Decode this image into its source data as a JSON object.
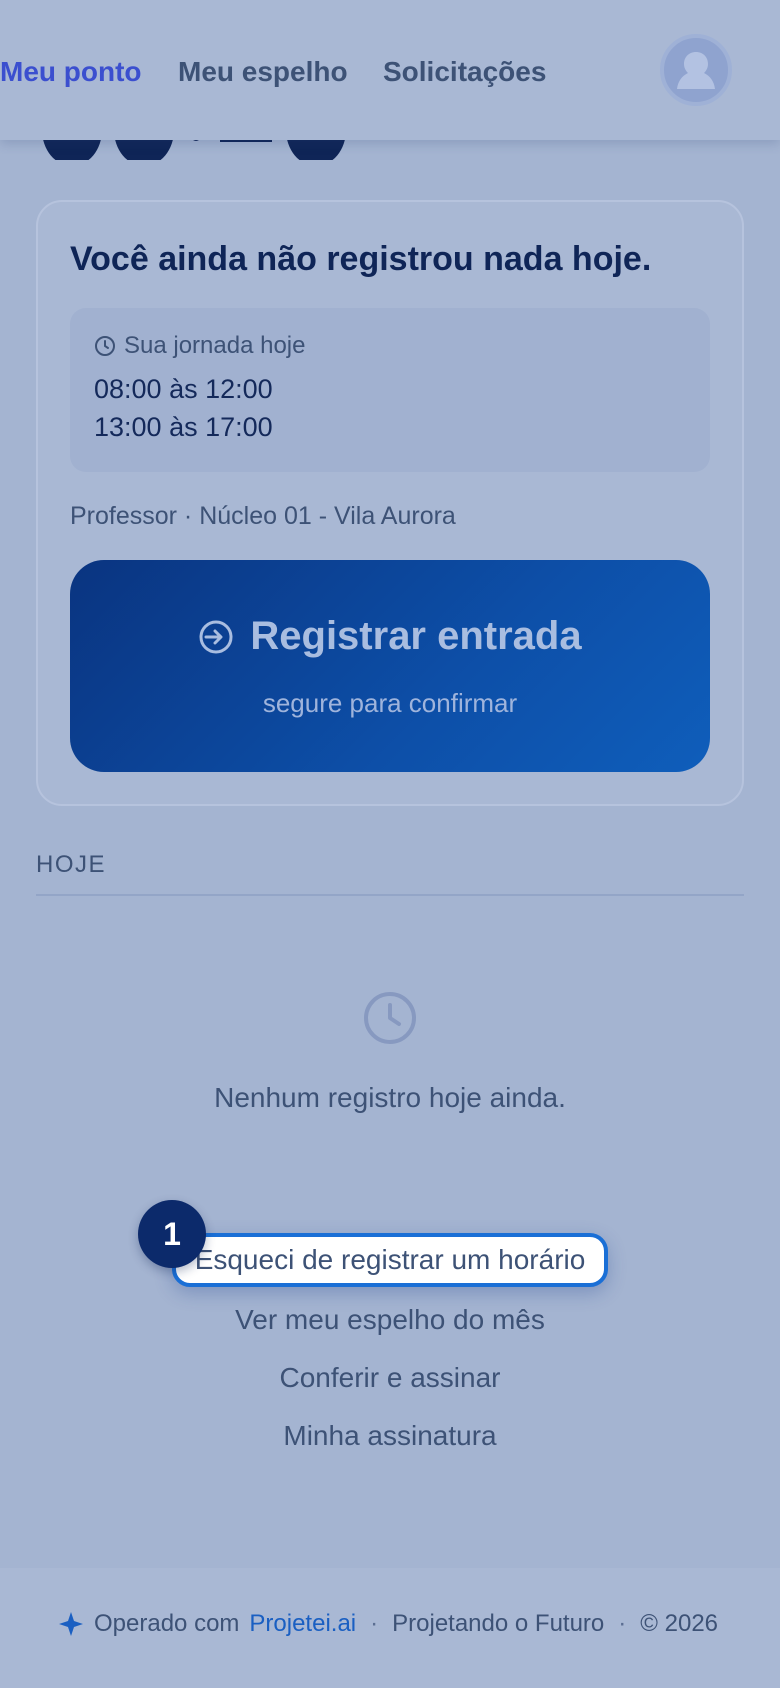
{
  "nav": {
    "tabs": [
      {
        "label": "Meu ponto",
        "active": true
      },
      {
        "label": "Meu espelho",
        "active": false
      },
      {
        "label": "Solicitações",
        "active": false
      }
    ]
  },
  "card": {
    "title": "Você ainda não registrou nada hoje.",
    "journey_label": "Sua jornada hoje",
    "journey_lines": [
      "08:00 às 12:00",
      "13:00 às 17:00"
    ],
    "role_text": "Professor · Núcleo 01 - Vila Aurora",
    "register_label": "Registrar entrada",
    "register_sub": "segure para confirmar"
  },
  "today": {
    "section_title": "HOJE",
    "empty_text": "Nenhum registro hoje ainda."
  },
  "links": {
    "forgot": "Esqueci de registrar um horário",
    "mirror": "Ver meu espelho do mês",
    "check_sign": "Conferir e assinar",
    "signature": "Minha assinatura"
  },
  "step_badge": "1",
  "footer": {
    "operated_with": "Operado com",
    "brand": "Projetei.ai",
    "slogan": "Projetando o Futuro",
    "copyright": "© 2026"
  },
  "colors": {
    "accent": "#3b4fcf",
    "primary_button": "#0d4fa8",
    "highlight_border": "#1a6fd6",
    "badge": "#0c2a6b"
  },
  "icons": {
    "avatar": "user-avatar-icon",
    "journey": "clock-icon",
    "register": "login-arrow-icon",
    "empty": "clock-icon",
    "footer": "sparkle-icon"
  }
}
